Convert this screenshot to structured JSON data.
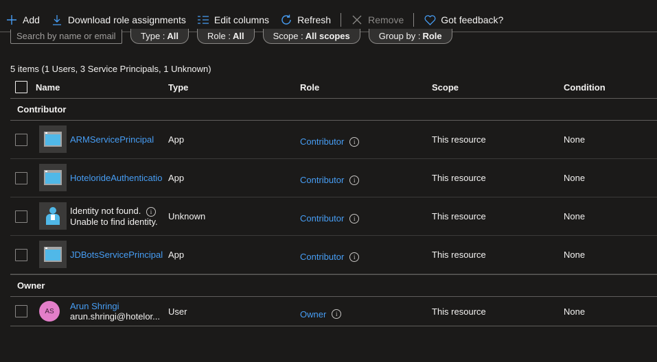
{
  "toolbar": {
    "add": "Add",
    "download": "Download role assignments",
    "edit_columns": "Edit columns",
    "refresh": "Refresh",
    "remove": "Remove",
    "feedback": "Got feedback?"
  },
  "filters": {
    "search_placeholder": "Search by name or email",
    "type_label": "Type :",
    "type_value": "All",
    "role_label": "Role :",
    "role_value": "All",
    "scope_label": "Scope :",
    "scope_value": "All scopes",
    "group_label": "Group by :",
    "group_value": "Role"
  },
  "summary": "5 items (1 Users, 3 Service Principals, 1 Unknown)",
  "columns": {
    "name": "Name",
    "type": "Type",
    "role": "Role",
    "scope": "Scope",
    "condition": "Condition"
  },
  "groups": [
    {
      "title": "Contributor",
      "rows": [
        {
          "name": "ARMServicePrincipal",
          "type": "App",
          "role": "Contributor",
          "scope": "This resource",
          "condition": "None"
        },
        {
          "name": "HotelorideAuthenticatio",
          "type": "App",
          "role": "Contributor",
          "scope": "This resource",
          "condition": "None"
        },
        {
          "name": "Identity not found.",
          "sub": "Unable to find identity.",
          "type": "Unknown",
          "role": "Contributor",
          "scope": "This resource",
          "condition": "None"
        },
        {
          "name": "JDBotsServicePrincipal",
          "type": "App",
          "role": "Contributor",
          "scope": "This resource",
          "condition": "None"
        }
      ]
    },
    {
      "title": "Owner",
      "rows": [
        {
          "name": "Arun Shringi",
          "sub": "arun.shringi@hotelor...",
          "initials": "AS",
          "type": "User",
          "role": "Owner",
          "scope": "This resource",
          "condition": "None"
        }
      ]
    }
  ],
  "colors": {
    "link": "#479ef5",
    "background": "#1b1a19",
    "user_avatar": "#e37ec9"
  }
}
